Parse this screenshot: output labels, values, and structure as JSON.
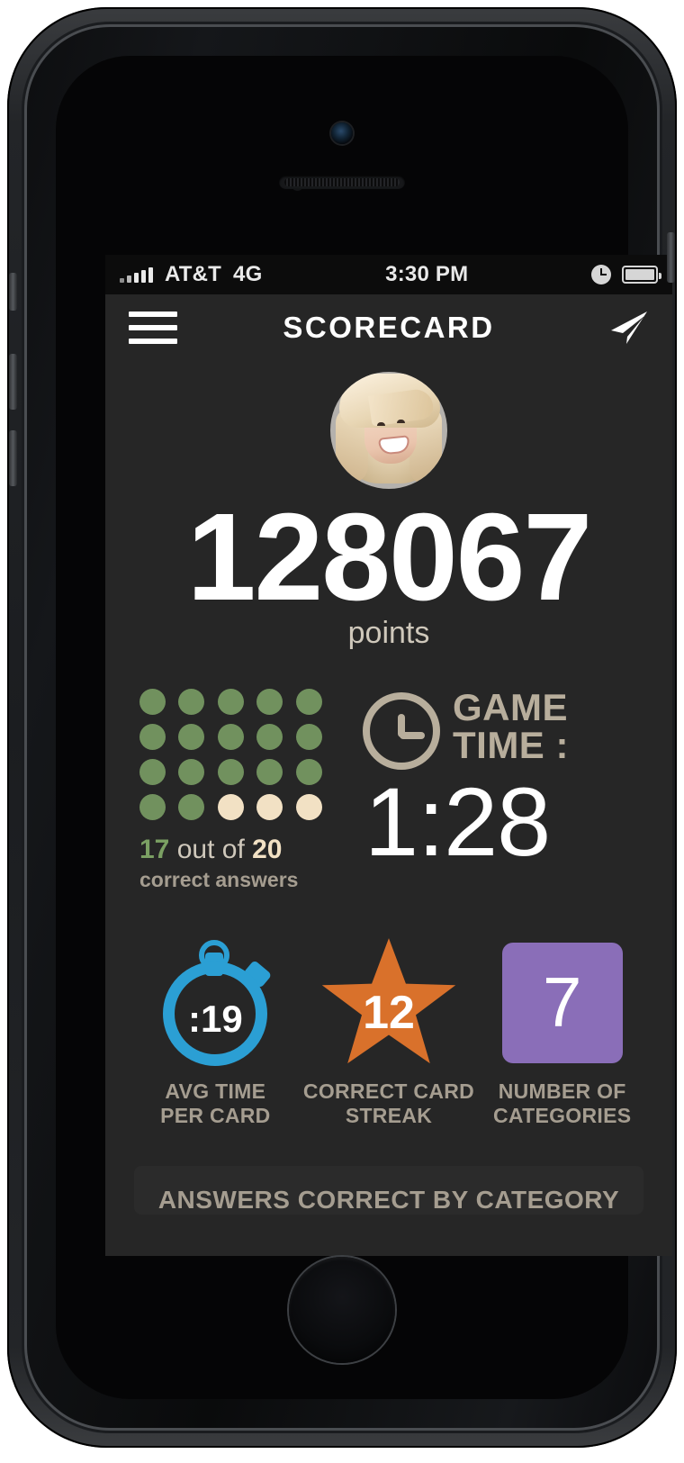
{
  "statusbar": {
    "carrier": "AT&T",
    "network": "4G",
    "time": "3:30 PM",
    "signal_icon": "signal-bars-icon",
    "alarm_icon": "alarm-clock-icon",
    "battery_icon": "battery-icon"
  },
  "navbar": {
    "menu_icon": "hamburger-menu-icon",
    "title": "SCORECARD",
    "share_icon": "send-paper-plane-icon"
  },
  "profile": {
    "avatar_alt": "user-avatar"
  },
  "score": {
    "value": "128067",
    "unit": "points"
  },
  "answers": {
    "total_dots": 20,
    "correct_dots": 17,
    "correct": "17",
    "connector": "out of",
    "total": "20",
    "caption": "correct answers",
    "dot_on_color": "#71915e",
    "dot_off_color": "#f2e1c4"
  },
  "game_time": {
    "clock_icon": "clock-icon",
    "label_line1": "GAME",
    "label_line2": "TIME :",
    "value": "1:28"
  },
  "stats": [
    {
      "icon": "stopwatch-icon",
      "value": ":19",
      "label_line1": "AVG TIME",
      "label_line2": "PER CARD",
      "color": "#2b9fd4"
    },
    {
      "icon": "star-icon",
      "value": "12",
      "label_line1": "CORRECT CARD",
      "label_line2": "STREAK",
      "color": "#d9712b"
    },
    {
      "icon": "rounded-square-icon",
      "value": "7",
      "label_line1": "NUMBER OF",
      "label_line2": "CATEGORIES",
      "color": "#8a6eb8"
    }
  ],
  "category_card": {
    "title": "ANSWERS CORRECT BY CATEGORY"
  }
}
